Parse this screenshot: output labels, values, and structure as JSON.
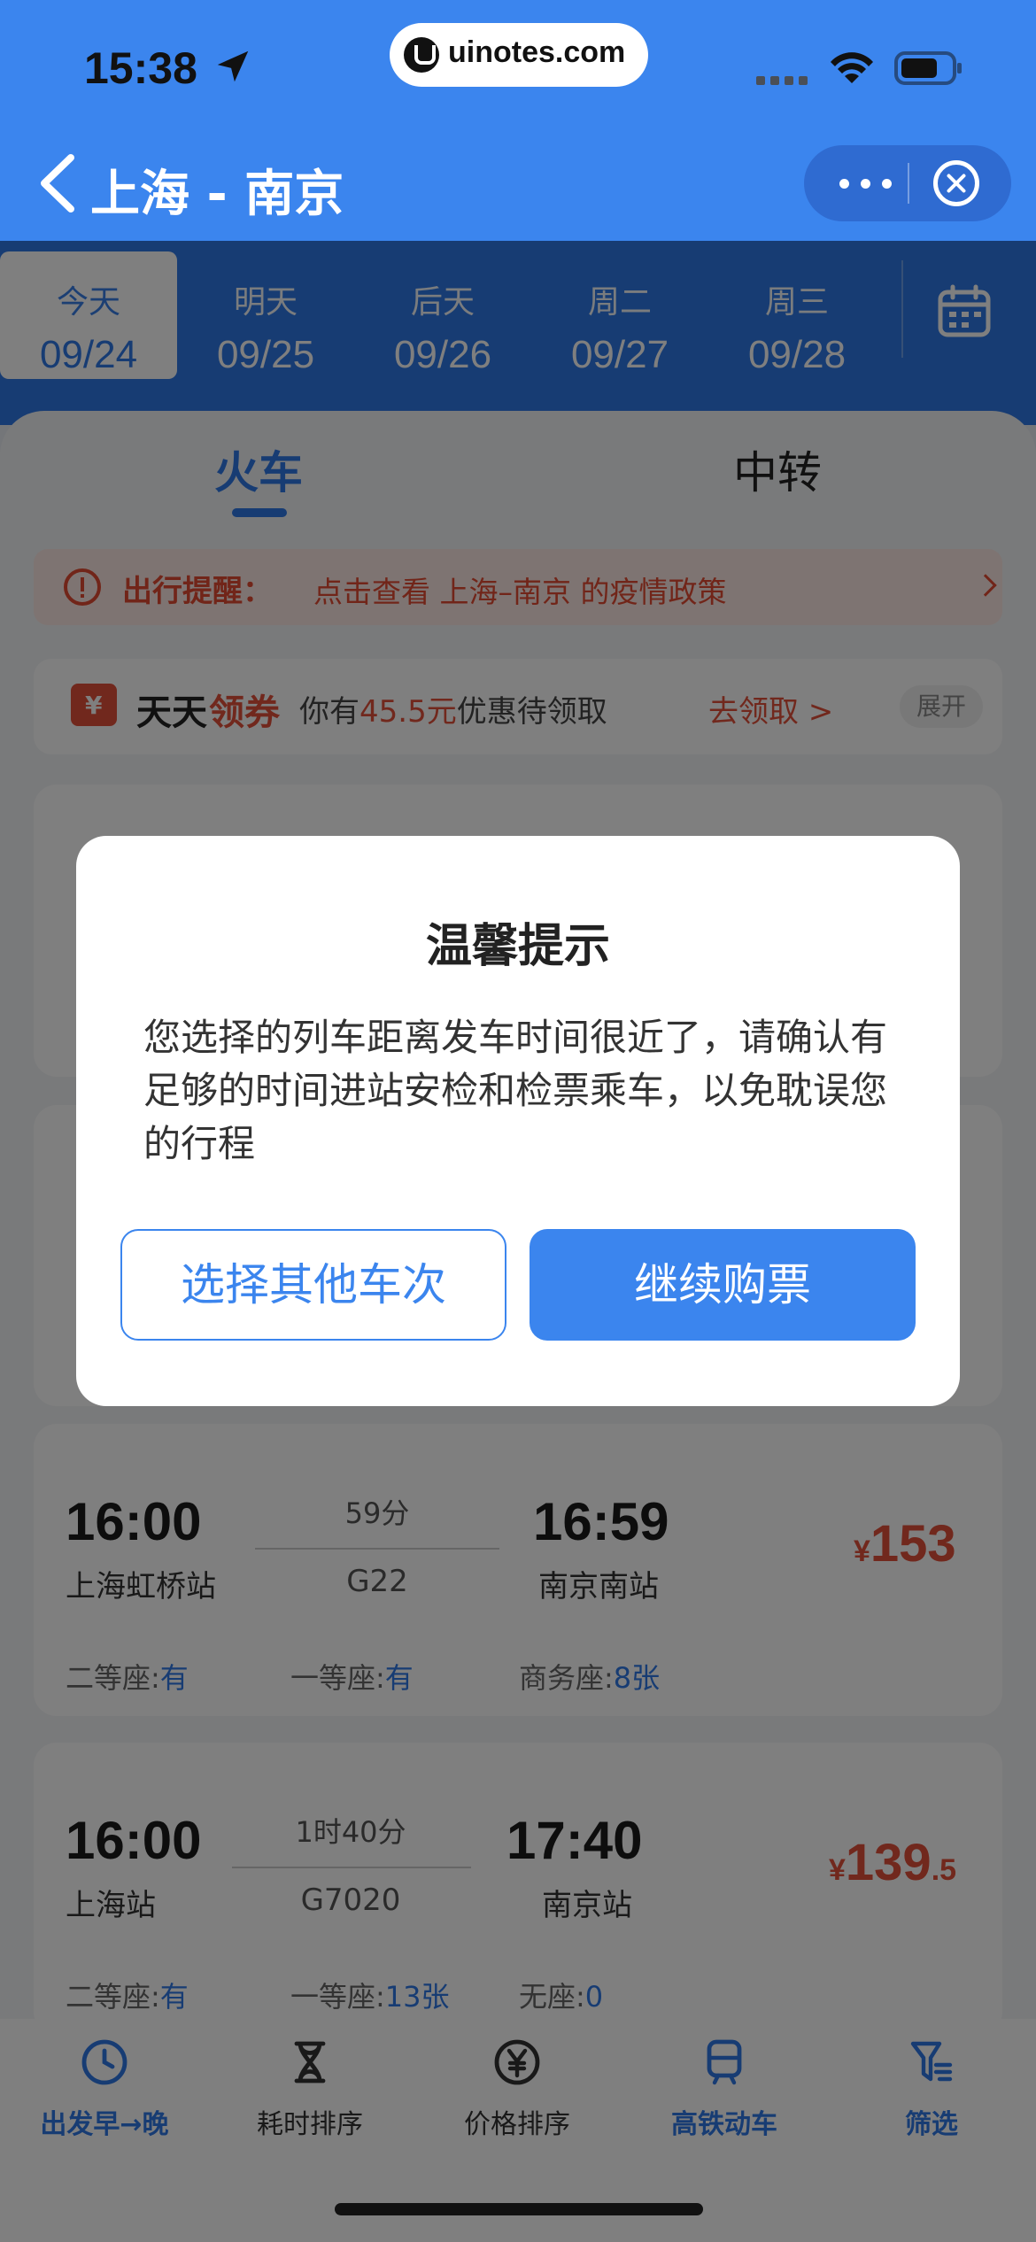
{
  "status": {
    "time": "15:38",
    "site": "uinotes.com"
  },
  "nav": {
    "title": "上海 - 南京"
  },
  "dates": [
    {
      "day": "今天",
      "date": "09/24",
      "active": true
    },
    {
      "day": "明天",
      "date": "09/25"
    },
    {
      "day": "后天",
      "date": "09/26"
    },
    {
      "day": "周二",
      "date": "09/27"
    },
    {
      "day": "周三",
      "date": "09/28"
    }
  ],
  "tabs": {
    "train": "火车",
    "transfer": "中转"
  },
  "notice": {
    "label": "出行提醒：",
    "message": "点击查看 上海–南京 的疫情政策"
  },
  "coupon": {
    "brand1": "天天",
    "brand2": "领券",
    "desc_prefix": "你有",
    "amount": "45.5元",
    "desc_suffix": "优惠待领取",
    "action": "去领取 >",
    "expand": "展开"
  },
  "trains": [
    {
      "dep_time": "16:00",
      "dep_station": "上海虹桥站",
      "duration": "59分",
      "number": "G22",
      "arr_time": "16:59",
      "arr_station": "南京南站",
      "price_symbol": "¥",
      "price_int": "153",
      "price_dec": "",
      "seats": [
        {
          "name": "二等座:",
          "value": "有"
        },
        {
          "name": "一等座:",
          "value": "有"
        },
        {
          "name": "商务座:",
          "value": "8张"
        }
      ]
    },
    {
      "dep_time": "16:00",
      "dep_station": "上海站",
      "duration": "1时40分",
      "number": "G7020",
      "arr_time": "17:40",
      "arr_station": "南京站",
      "price_symbol": "¥",
      "price_int": "139",
      "price_dec": ".5",
      "seats": [
        {
          "name": "二等座:",
          "value": "有"
        },
        {
          "name": "一等座:",
          "value": "13张"
        },
        {
          "name": "无座:",
          "value": "0"
        }
      ]
    }
  ],
  "toolbar": [
    {
      "label": "出发早→晚",
      "icon": "clock-icon",
      "active": true
    },
    {
      "label": "耗时排序",
      "icon": "hourglass-icon"
    },
    {
      "label": "价格排序",
      "icon": "yen-icon"
    },
    {
      "label": "高铁动车",
      "icon": "train-icon",
      "active": true
    },
    {
      "label": "筛选",
      "icon": "filter-icon",
      "active": true
    }
  ],
  "modal": {
    "title": "温馨提示",
    "body": "您选择的列车距离发车时间很近了，请确认有足够的时间进站安检和检票乘车，以免耽误您的行程",
    "secondary": "选择其他车次",
    "primary": "继续购票"
  },
  "colors": {
    "brand_blue": "#3b85ee",
    "price_red": "#e3503a"
  }
}
